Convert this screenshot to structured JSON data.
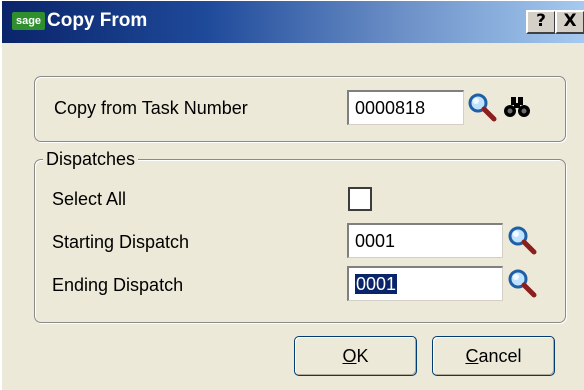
{
  "window": {
    "logo_text": "sage",
    "title": "Copy From",
    "help_label": "?",
    "close_label": "X"
  },
  "task_group": {
    "label": "Copy from Task Number",
    "value": "0000818"
  },
  "dispatch_group": {
    "legend": "Dispatches",
    "select_all_label": "Select All",
    "select_all_checked": false,
    "starting_label": "Starting Dispatch",
    "starting_value": "0001",
    "ending_label": "Ending Dispatch",
    "ending_value": "0001"
  },
  "buttons": {
    "ok_mnemonic": "O",
    "ok_rest": "K",
    "cancel_mnemonic": "C",
    "cancel_rest": "ancel"
  },
  "icons": {
    "lookup": "magnifier-icon",
    "search": "binoculars-icon"
  }
}
